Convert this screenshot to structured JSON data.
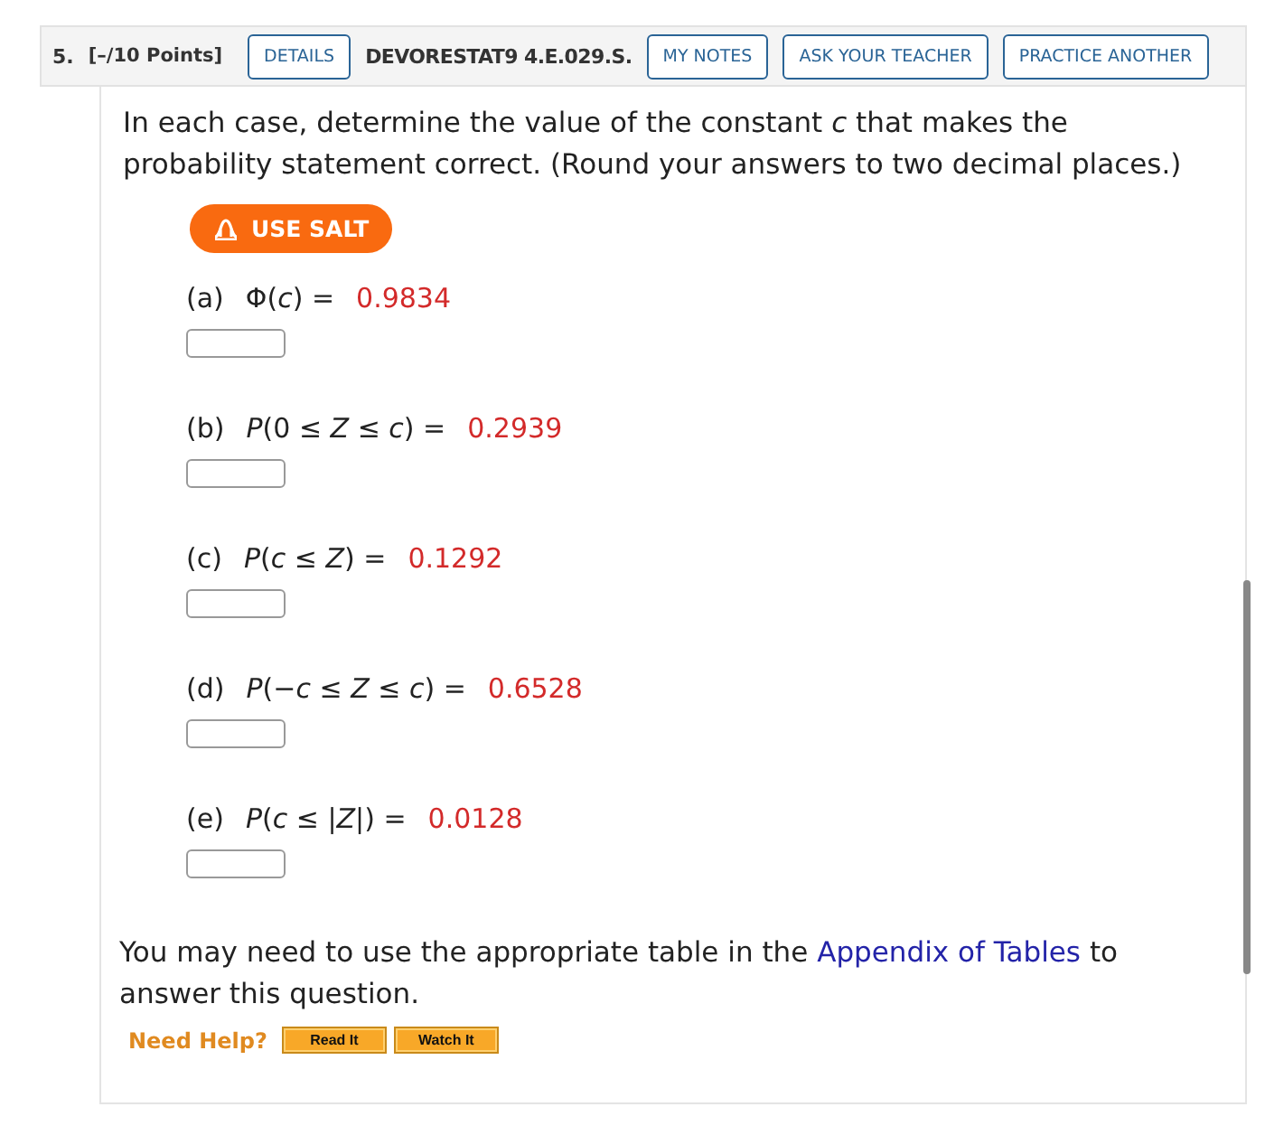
{
  "header": {
    "number": "5.",
    "points": "[–/10 Points]",
    "details_button": "DETAILS",
    "problem_id": "DEVORESTAT9 4.E.029.S.",
    "buttons": [
      "MY NOTES",
      "ASK YOUR TEACHER",
      "PRACTICE ANOTHER"
    ]
  },
  "prompt": "In each case, determine the value of the constant *c* that makes the probability statement correct. (Round your answers to two decimal places.)",
  "salt_button": "USE SALT",
  "parts": [
    {
      "label": "(a)",
      "expression": "Φ(*c*) =",
      "value": "0.9834"
    },
    {
      "label": "(b)",
      "expression": "*P*(0 ≤ *Z* ≤ *c*) =",
      "value": "0.2939"
    },
    {
      "label": "(c)",
      "expression": "*P*(*c* ≤ *Z*) =",
      "value": "0.1292"
    },
    {
      "label": "(d)",
      "expression": "*P*(−*c* ≤ *Z* ≤ *c*) =",
      "value": "0.6528"
    },
    {
      "label": "(e)",
      "expression": "*P*(*c* ≤ |*Z*|) =",
      "value": "0.0128"
    }
  ],
  "note": {
    "before": "You may need to use the appropriate table in the",
    "link": "Appendix of Tables",
    "after": "to answer this question."
  },
  "help": {
    "label": "Need Help?",
    "buttons": [
      "Read It",
      "Watch It"
    ]
  }
}
